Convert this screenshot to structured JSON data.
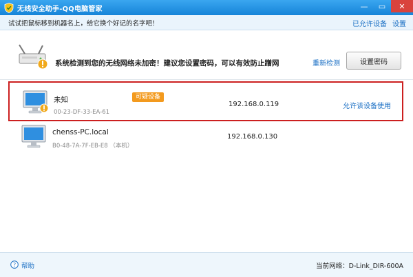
{
  "window": {
    "title": "无线安全助手-QQ电脑管家",
    "controls": {
      "minimize": "—",
      "restore": "▭",
      "close": "✕"
    }
  },
  "tipbar": {
    "text": "试试把鼠标移到机器名上，给它换个好记的名字吧！",
    "allowed_devices_link": "已允许设备",
    "settings_link": "设置"
  },
  "warning": {
    "message": "系统检测到您的无线网络未加密！建议您设置密码，可以有效防止蹭网",
    "rescan_label": "重新检测",
    "set_password_label": "设置密码"
  },
  "devices": [
    {
      "name": "未知",
      "mac": "00-23-DF-33-EA-61",
      "badge": "可疑设备",
      "ip": "192.168.0.119",
      "action": "允许该设备使用"
    },
    {
      "name": "chenss-PC.local",
      "mac": "B0-48-7A-7F-EB-E8 （本机）",
      "ip": "192.168.0.130"
    }
  ],
  "footer": {
    "help_label": "帮助",
    "current_network_label": "当前网络：",
    "current_network": "D-Link_DIR-600A"
  },
  "icons": {
    "title": "shield-icon",
    "router": "router-icon",
    "warning": "warning-icon",
    "monitor": "monitor-icon",
    "help": "help-icon"
  },
  "colors": {
    "titlebar": "#1684d8",
    "link": "#1a6fc4",
    "suspect_badge": "#f39a1e",
    "highlight_border": "#cc1f1f",
    "close_button": "#d9433c"
  }
}
